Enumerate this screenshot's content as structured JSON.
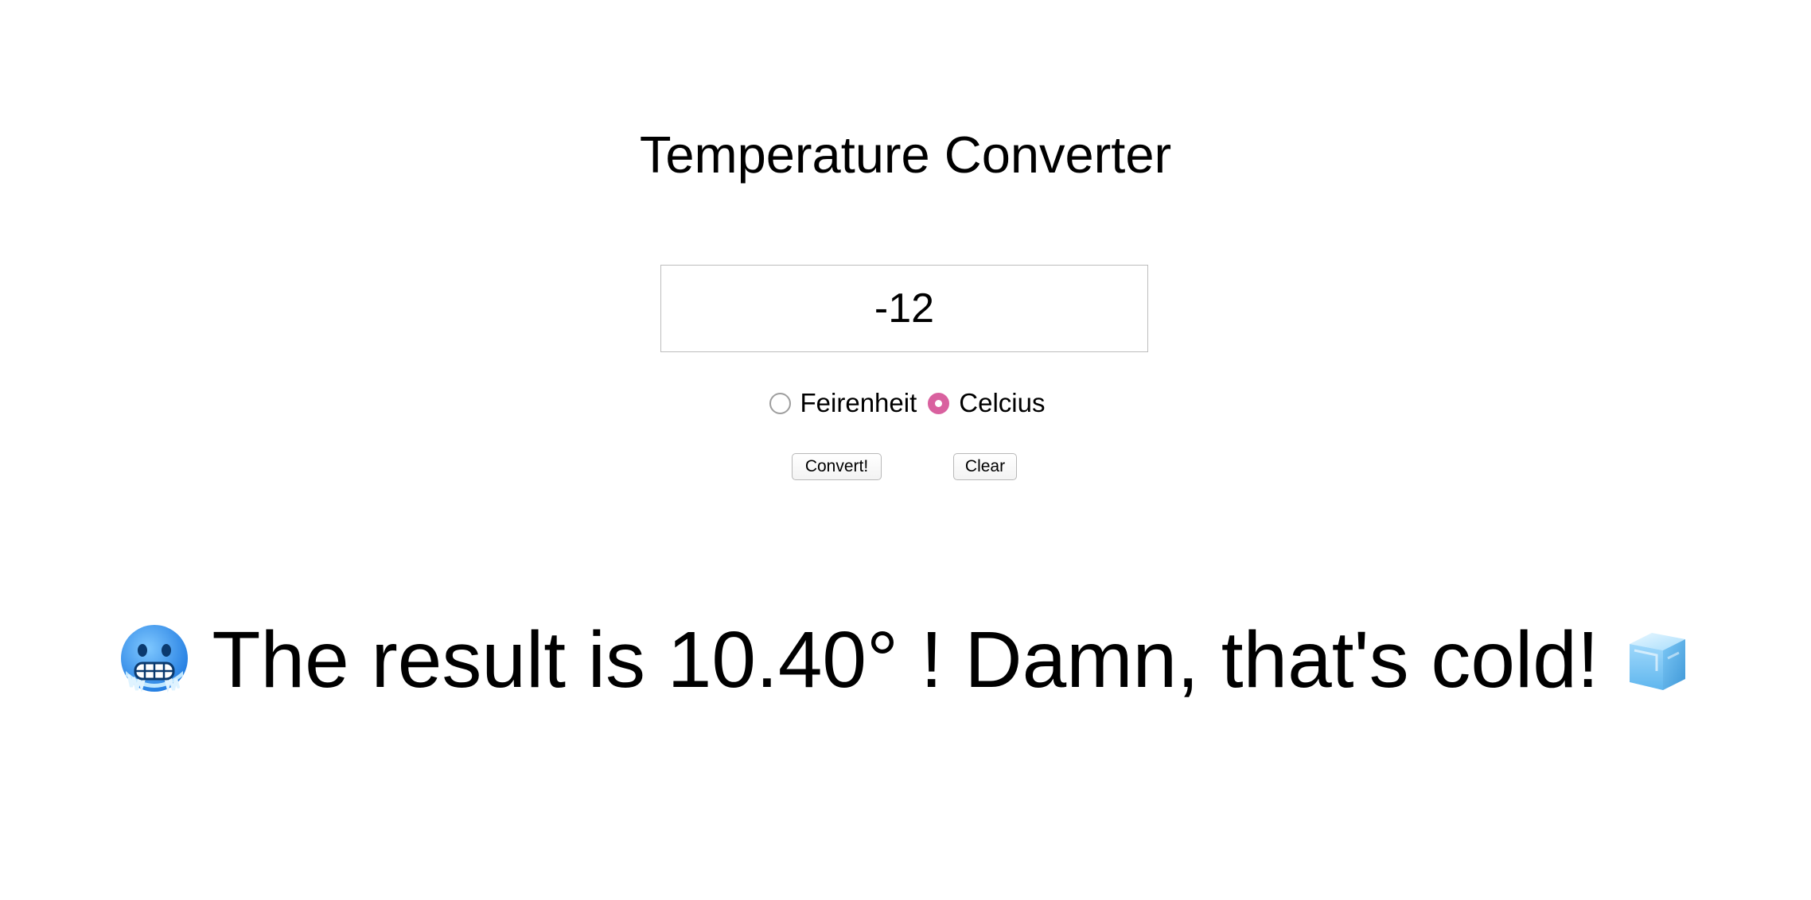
{
  "page": {
    "title": "Temperature Converter"
  },
  "input": {
    "value": "-12"
  },
  "units": {
    "options": [
      {
        "label": "Feirenheit",
        "selected": false
      },
      {
        "label": "Celcius",
        "selected": true
      }
    ],
    "accent_color": "#d9619f"
  },
  "buttons": {
    "convert_label": "Convert!",
    "clear_label": "Clear"
  },
  "result": {
    "text": "The result is 10.40° ! Damn, that's cold!",
    "leading_icon": "freezing-face-icon",
    "trailing_icon": "ice-cube-icon"
  }
}
